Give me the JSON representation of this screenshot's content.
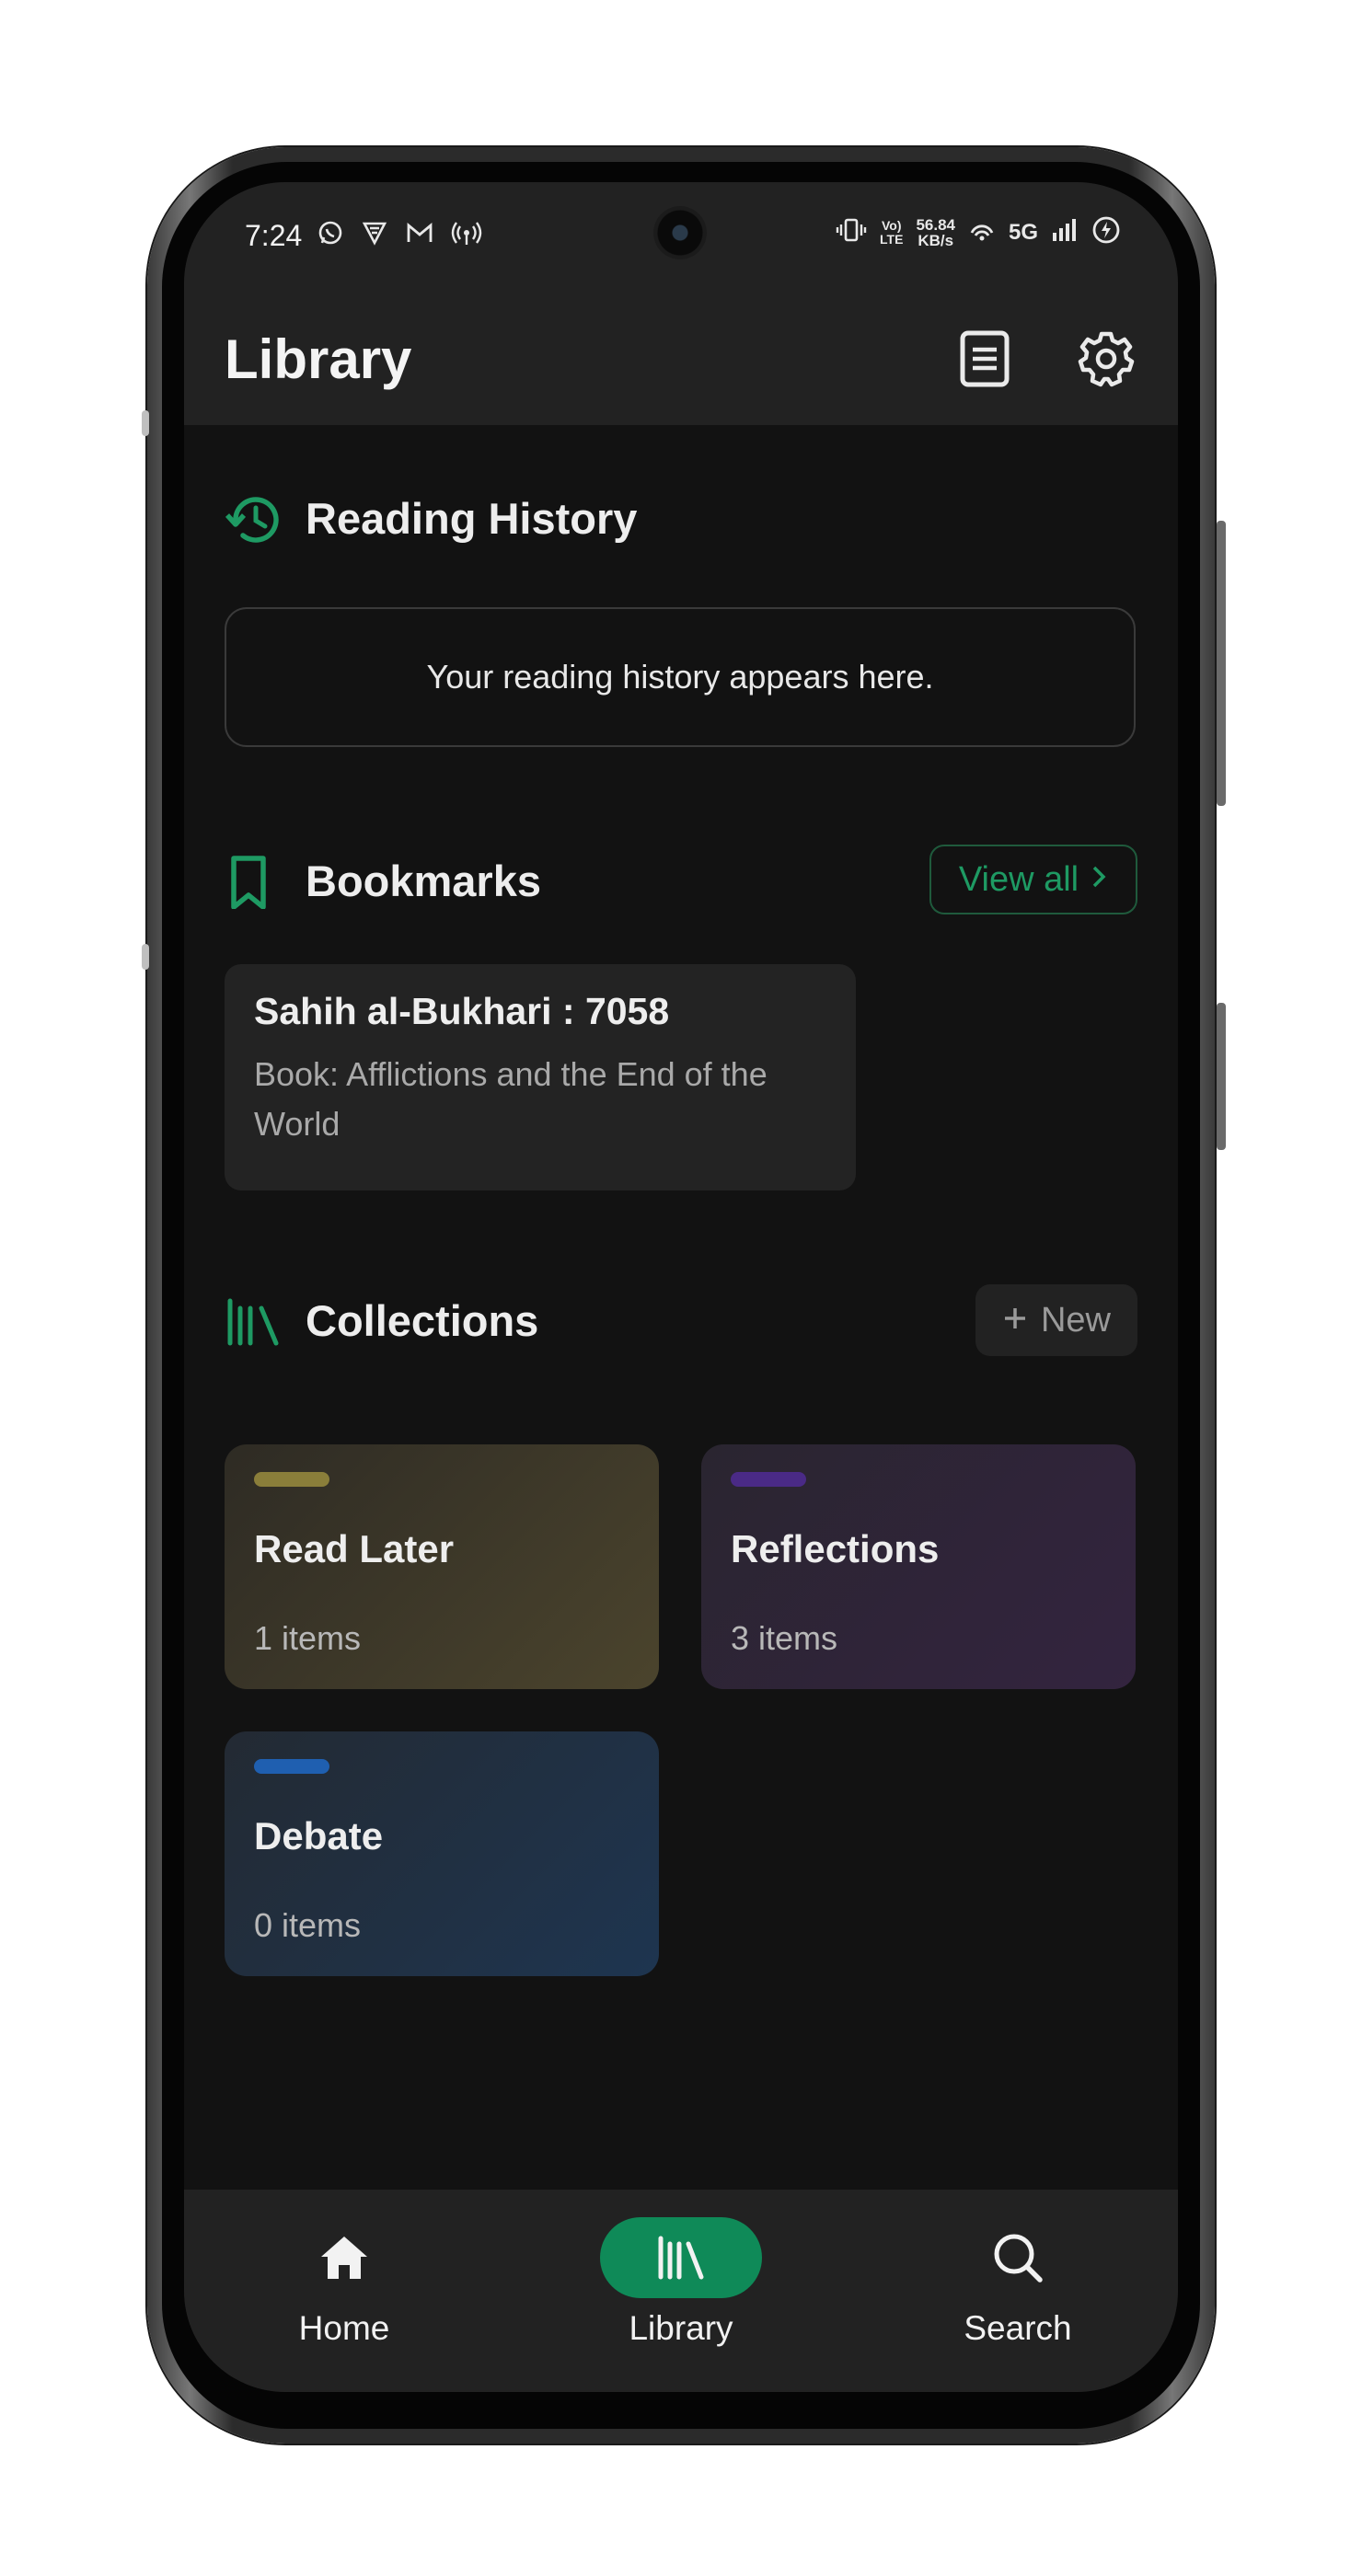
{
  "status_bar": {
    "time": "7:24",
    "net_speed_value": "56.84",
    "net_speed_unit": "KB/s",
    "volte_line1": "Vo)",
    "volte_line2": "LTE",
    "network": "5G",
    "notification_icons": [
      "whatsapp-icon",
      "vpn-icon",
      "gmail-icon",
      "hotspot-icon"
    ],
    "system_icons": [
      "vibrate-icon",
      "wifi-icon",
      "signal-icon",
      "battery-charging-icon"
    ]
  },
  "appbar": {
    "title": "Library",
    "actions": [
      "book-icon",
      "settings-gear-icon"
    ]
  },
  "reading_history": {
    "title": "Reading History",
    "icon": "history-icon",
    "empty_text": "Your reading history appears here."
  },
  "bookmarks": {
    "title": "Bookmarks",
    "icon": "bookmark-icon",
    "view_all_label": "View all",
    "items": [
      {
        "title": "Sahih al-Bukhari : 7058",
        "book": "Book: Afflictions and the End of the World"
      }
    ]
  },
  "collections": {
    "title": "Collections",
    "icon": "library-icon",
    "new_label": "New",
    "items": [
      {
        "name": "Read Later",
        "count": "1 items",
        "accent": "#8a7e3a"
      },
      {
        "name": "Reflections",
        "count": "3 items",
        "accent": "#4a2a86"
      },
      {
        "name": "Debate",
        "count": "0 items",
        "accent": "#1f5fb0"
      }
    ]
  },
  "bottom_nav": {
    "items": [
      {
        "label": "Home",
        "icon": "home-icon"
      },
      {
        "label": "Library",
        "icon": "library-icon",
        "active": true
      },
      {
        "label": "Search",
        "icon": "search-icon"
      }
    ]
  },
  "colors": {
    "accent_green": "#1e9a63",
    "active_nav_green": "#0f8a58",
    "background": "#121212",
    "surface": "#222222"
  }
}
